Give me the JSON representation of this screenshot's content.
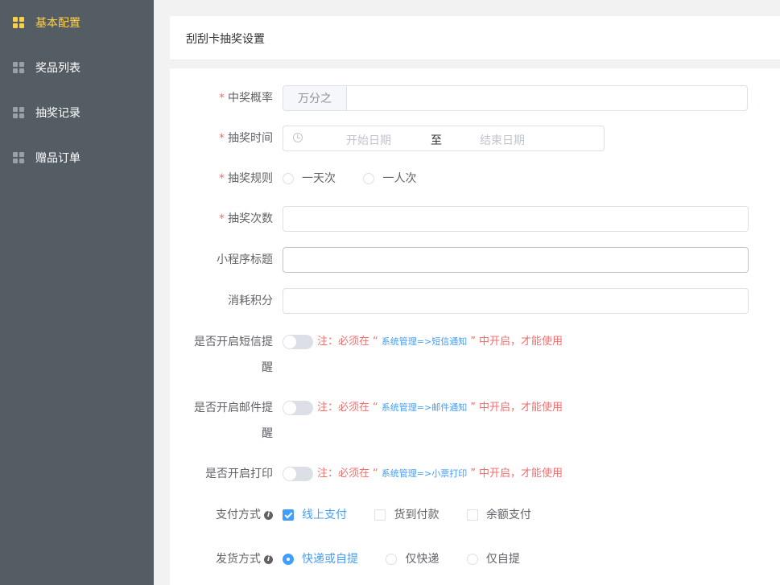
{
  "sidebar": {
    "items": [
      {
        "label": "基本配置",
        "icon": "grid-icon",
        "active": true
      },
      {
        "label": "奖品列表",
        "icon": "grid-icon"
      },
      {
        "label": "抽奖记录",
        "icon": "grid-icon"
      },
      {
        "label": "赠品订单",
        "icon": "grid-icon"
      }
    ]
  },
  "header": {
    "title": "刮刮卡抽奖设置"
  },
  "form": {
    "rate": {
      "label": "中奖概率",
      "prepend": "万分之",
      "value": ""
    },
    "time": {
      "label": "抽奖时间",
      "start_placeholder": "开始日期",
      "separator": "至",
      "end_placeholder": "结束日期"
    },
    "rule": {
      "label": "抽奖规则",
      "options": [
        "一天次",
        "一人次"
      ]
    },
    "count": {
      "label": "抽奖次数",
      "value": ""
    },
    "mini_title": {
      "label": "小程序标题",
      "value": ""
    },
    "points": {
      "label": "消耗积分",
      "value": ""
    },
    "sms": {
      "label_line1": "是否开启短信提",
      "label_line2": "醒",
      "note_prefix": "注：必须在",
      "open_quote": "“",
      "link": "系统管理=>短信通知",
      "close_quote": "”",
      "note_suffix": "中开启，才能使用"
    },
    "email": {
      "label_line1": "是否开启邮件提",
      "label_line2": "醒",
      "note_prefix": "注：必须在",
      "open_quote": "“",
      "link": "系统管理=>邮件通知",
      "close_quote": "”",
      "note_suffix": "中开启，才能使用"
    },
    "print": {
      "label": "是否开启打印",
      "note_prefix": "注：必须在",
      "open_quote": "“",
      "link": "系统管理=>小票打印",
      "close_quote": "”",
      "note_suffix": "中开启，才能使用"
    },
    "payment": {
      "label": "支付方式",
      "info": "i",
      "options": [
        {
          "label": "线上支付",
          "checked": true
        },
        {
          "label": "货到付款",
          "checked": false
        },
        {
          "label": "余额支付",
          "checked": false
        }
      ]
    },
    "shipping": {
      "label": "发货方式",
      "info": "i",
      "options": [
        {
          "label": "快递或自提",
          "checked": true
        },
        {
          "label": "仅快递",
          "checked": false
        },
        {
          "label": "仅自提",
          "checked": false
        }
      ]
    },
    "required_mark": "*"
  },
  "colors": {
    "sidebar_bg": "#545c64",
    "active": "#ffd04b",
    "primary": "#409eff",
    "danger": "#f56c6c"
  }
}
